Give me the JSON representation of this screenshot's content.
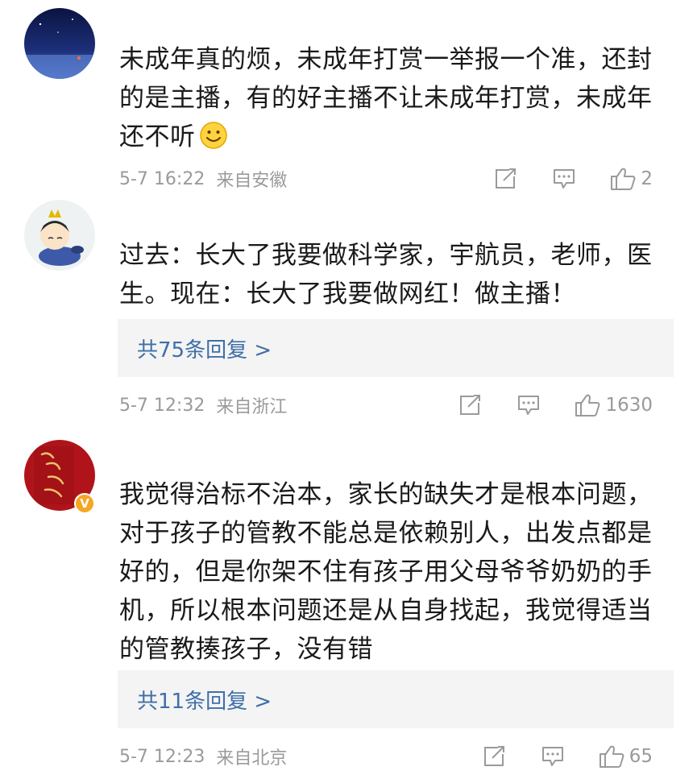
{
  "comments": [
    {
      "text": "未成年真的烦，未成年打赏一举报一个准，还封的是主播，有的好主播不让未成年打赏，未成年还不听",
      "time": "5-7 16:22",
      "location": "来自安徽",
      "likes": "2",
      "icons": [
        "share-icon",
        "comment-icon",
        "like-icon"
      ]
    },
    {
      "text": "过去：长大了我要做科学家，宇航员，老师，医生。现在：长大了我要做网红！做主播！",
      "reply": "共75条回复 >",
      "time": "5-7 12:32",
      "location": "来自浙江",
      "likes": "1630"
    },
    {
      "text": "我觉得治标不治本，家长的缺失才是根本问题，对于孩子的管教不能总是依赖别人，出发点都是好的，但是你架不住有孩子用父母爷爷奶奶的手机，所以根本问题还是从自身找起，我觉得适当的管教揍孩子，没有错",
      "verified": "V",
      "reply": "共11条回复 >",
      "time": "5-7 12:23",
      "location": "来自北京",
      "likes": "65"
    }
  ],
  "colors": {
    "link": "#3f6fa8",
    "meta": "#9a9a9a",
    "reply_bg": "#f4f4f4",
    "verified": "#f5a623"
  }
}
